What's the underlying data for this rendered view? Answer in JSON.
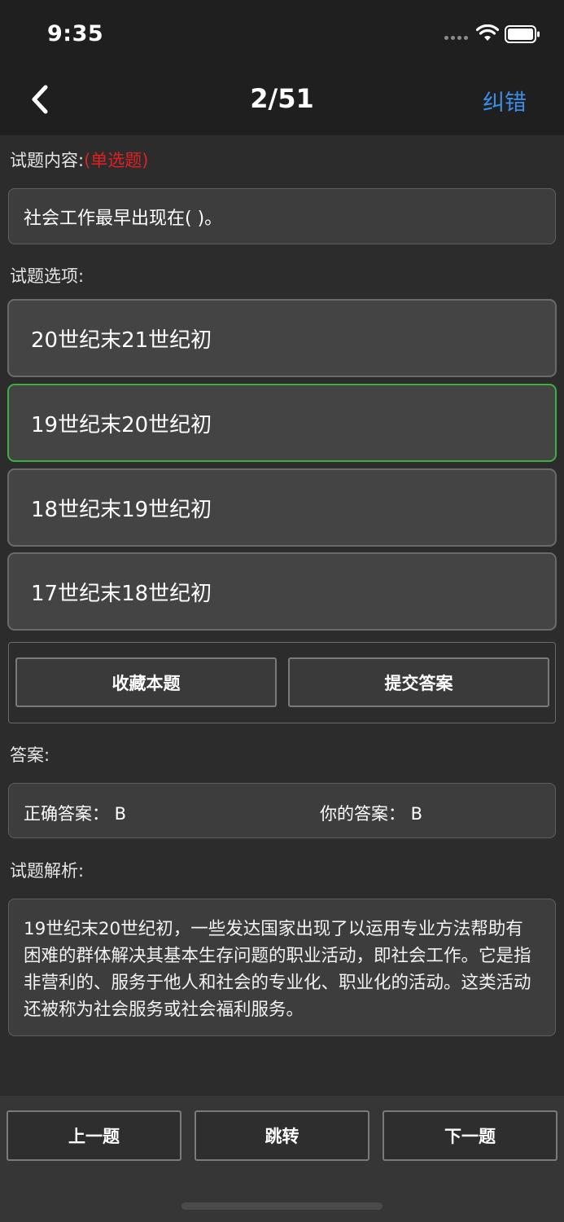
{
  "status": {
    "time": "9:35"
  },
  "nav": {
    "title": "2/51",
    "action": "纠错"
  },
  "question": {
    "label": "试题内容:",
    "type": "(单选题)",
    "text": "社会工作最早出现在(   )。"
  },
  "options": {
    "label": "试题选项:",
    "items": [
      "20世纪末21世纪初",
      "19世纪末20世纪初",
      "18世纪末19世纪初",
      "17世纪末18世纪初"
    ],
    "selected_index": 1
  },
  "actions": {
    "favorite": "收藏本题",
    "submit": "提交答案"
  },
  "answer": {
    "label": "答案:",
    "correct": "正确答案： B",
    "yours": "你的答案： B"
  },
  "analysis": {
    "label": "试题解析:",
    "text": "19世纪末20世纪初，一些发达国家出现了以运用专业方法帮助有困难的群体解决其基本生存问题的职业活动，即社会工作。它是指非营利的、服务于他人和社会的专业化、职业化的活动。这类活动还被称为社会服务或社会福利服务。"
  },
  "bottom": {
    "prev": "上一题",
    "jump": "跳转",
    "next": "下一题"
  },
  "colors": {
    "accent": "#3a8ee6",
    "selected_border": "#3dad44",
    "type_red": "#e02020"
  }
}
